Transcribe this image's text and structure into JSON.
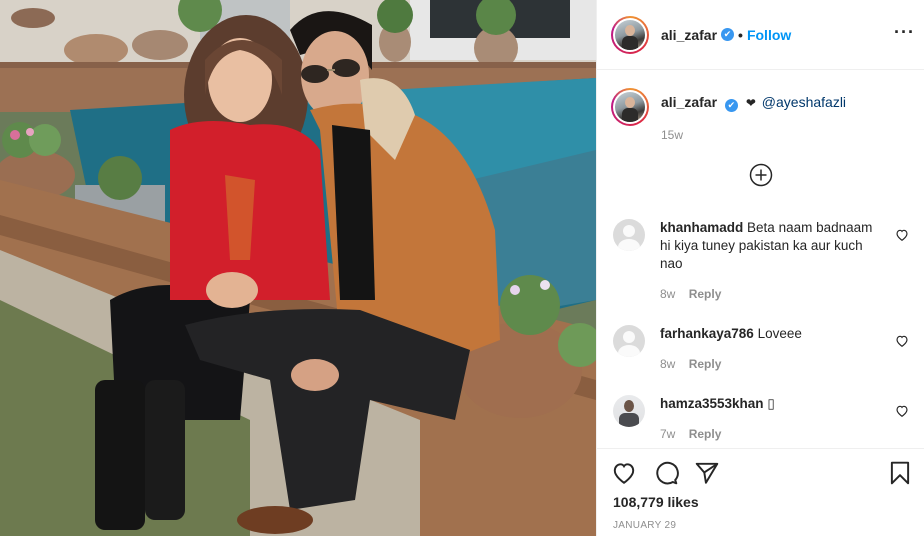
{
  "header": {
    "username": "ali_zafar",
    "verified_glyph": "✔",
    "separator": "•",
    "follow_label": "Follow",
    "more_glyph": "···"
  },
  "caption": {
    "username": "ali_zafar",
    "verified_glyph": "✔",
    "heart_glyph": "❤",
    "mention": "@ayeshafazli",
    "time": "15w"
  },
  "comments": [
    {
      "username": "khanhamadd",
      "text": "Beta naam badnaam hi kiya tuney pakistan ka aur kuch nao",
      "time": "8w",
      "reply_label": "Reply"
    },
    {
      "username": "farhankaya786",
      "text": "Loveee",
      "time": "8w",
      "reply_label": "Reply"
    },
    {
      "username": "hamza3553khan",
      "text": "▯",
      "time": "7w",
      "reply_label": "Reply"
    }
  ],
  "footer": {
    "likes": "108,779 likes",
    "date": "JANUARY 29"
  },
  "icons": {
    "verified": "verified-badge-icon",
    "load_more": "plus-circle-icon",
    "like": "heart-icon",
    "comment": "comment-bubble-icon",
    "share": "paper-plane-icon",
    "save": "bookmark-icon",
    "comment_like": "small-heart-icon"
  },
  "colors": {
    "accent": "#0095f6",
    "mention": "#00376b",
    "muted": "#8e8e8e",
    "text": "#262626"
  }
}
